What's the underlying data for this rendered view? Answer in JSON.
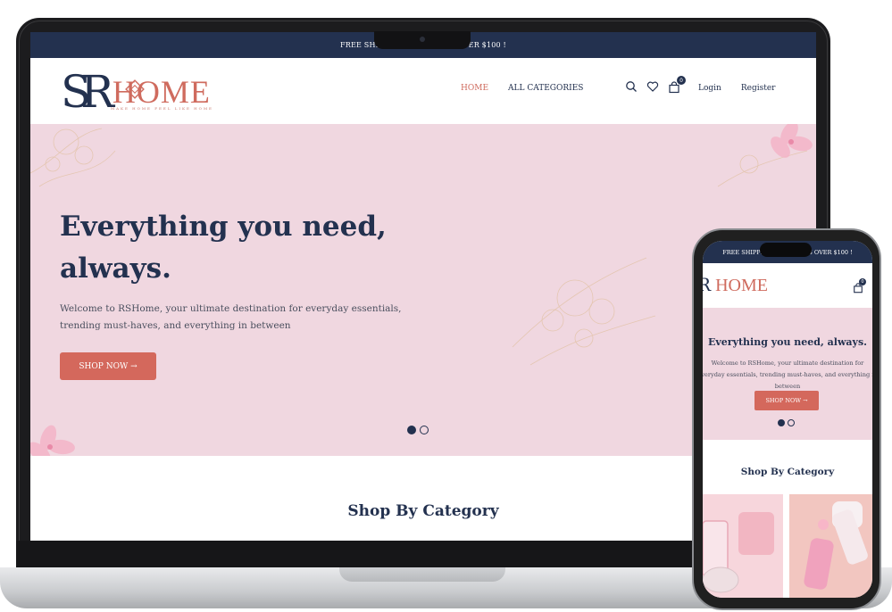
{
  "laptop": {
    "announcement": "FREE SHIPPING ON ORDERS OVER $100 !",
    "logo": {
      "mark": "SR",
      "word": "HOME",
      "tagline": "MAKE HOME FEEL LIKE HOME"
    },
    "nav": {
      "home": "HOME",
      "categories": "ALL CATEGORIES"
    },
    "header": {
      "cart_count": "0",
      "login": "Login",
      "register": "Register"
    },
    "hero": {
      "title": "Everything you need, always.",
      "description": "Welcome to RSHome, your ultimate destination for everyday essentials, trending must-haves, and everything in between",
      "button": "SHOP NOW →",
      "slide_active": 1,
      "slides": 2
    },
    "section_title": "Shop By Category"
  },
  "phone": {
    "announcement": "FREE SHIPPING ON ORDERS OVER $100 !",
    "logo": {
      "mark": "R",
      "word": "HOME"
    },
    "cart_count": "0",
    "hero": {
      "title": "Everything you need, always.",
      "description": "Welcome to RSHome, your ultimate destination for everyday essentials, trending must-haves, and everything in between",
      "button": "SHOP NOW →"
    },
    "section_title": "Shop By Category"
  },
  "colors": {
    "navy": "#23314f",
    "coral": "#d4685c",
    "hero_pink": "#f0d7e0"
  }
}
